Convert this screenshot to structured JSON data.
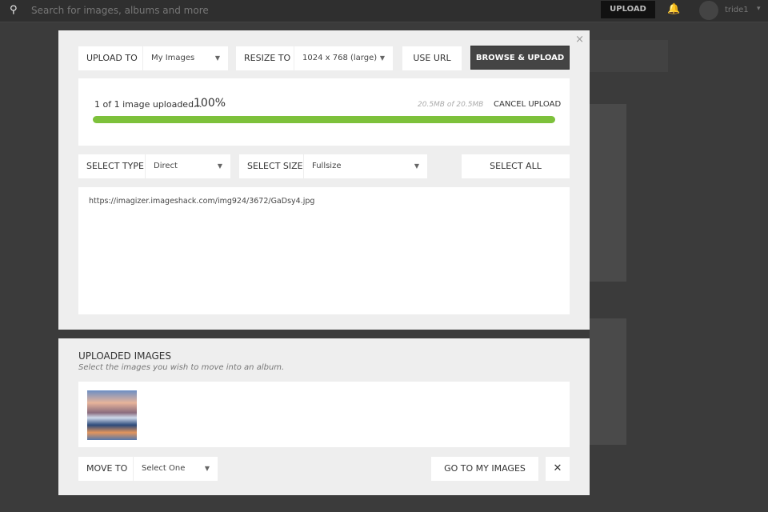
{
  "topbar": {
    "search_placeholder": "Search for images, albums and more",
    "upload": "UPLOAD",
    "user": "tride1"
  },
  "modal": {
    "close": "×",
    "upload_to_label": "UPLOAD TO",
    "upload_to_value": "My Images",
    "resize_label": "RESIZE TO",
    "resize_value": "1024 x 768 (large)",
    "use_url": "USE URL",
    "browse": "BROWSE & UPLOAD",
    "progress": {
      "status": "1 of 1 image uploaded...",
      "percent": "100%",
      "size": "20.5MB of 20.5MB",
      "cancel": "CANCEL UPLOAD",
      "value": 100
    },
    "select_type_label": "SELECT TYPE",
    "select_type_value": "Direct",
    "select_size_label": "SELECT SIZE",
    "select_size_value": "Fullsize",
    "select_all": "SELECT ALL",
    "link": "https://imagizer.imageshack.com/img924/3672/GaDsy4.jpg"
  },
  "uploaded": {
    "title": "UPLOADED IMAGES",
    "subtitle": "Select the images you wish to move into an album.",
    "move_to_label": "MOVE TO",
    "move_to_value": "Select One",
    "go": "GO TO MY IMAGES",
    "close": "✕"
  },
  "colors": {
    "progress": "#7dc13b"
  }
}
